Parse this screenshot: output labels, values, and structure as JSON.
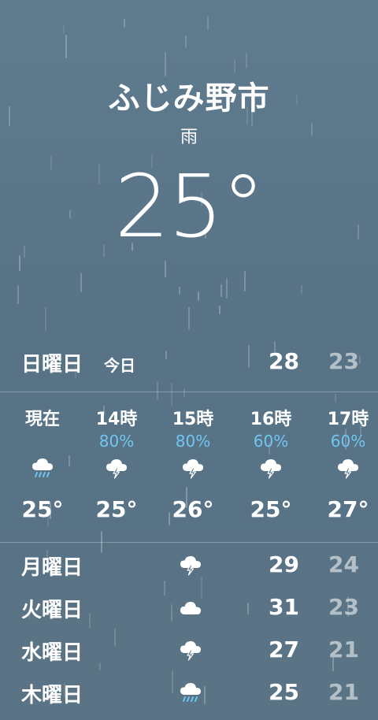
{
  "location": {
    "city": "ふじみ野市",
    "condition": "雨",
    "temperature": "25°"
  },
  "today": {
    "day": "日曜日",
    "label": "今日",
    "high": "28",
    "low": "23"
  },
  "hourly": [
    {
      "label": "現在",
      "precip": "",
      "icon": "rain-cloud-icon",
      "temp": "25°"
    },
    {
      "label": "14時",
      "precip": "80%",
      "icon": "thunderstorm-cloud-icon",
      "temp": "25°"
    },
    {
      "label": "15時",
      "precip": "80%",
      "icon": "thunderstorm-cloud-icon",
      "temp": "26°"
    },
    {
      "label": "16時",
      "precip": "60%",
      "icon": "thunderstorm-cloud-icon",
      "temp": "25°"
    },
    {
      "label": "17時",
      "precip": "60%",
      "icon": "thunderstorm-cloud-icon",
      "temp": "27°"
    }
  ],
  "daily": [
    {
      "day": "月曜日",
      "icon": "thunderstorm-cloud-icon",
      "high": "29",
      "low": "24"
    },
    {
      "day": "火曜日",
      "icon": "cloud-icon",
      "high": "31",
      "low": "23"
    },
    {
      "day": "水曜日",
      "icon": "thunderstorm-cloud-icon",
      "high": "27",
      "low": "21"
    },
    {
      "day": "木曜日",
      "icon": "rain-cloud-icon",
      "high": "25",
      "low": "21"
    }
  ],
  "colors": {
    "background": "#5f7b8e",
    "precipitation": "#6fc6f3",
    "low_temperature": "rgba(255,255,255,0.55)"
  }
}
